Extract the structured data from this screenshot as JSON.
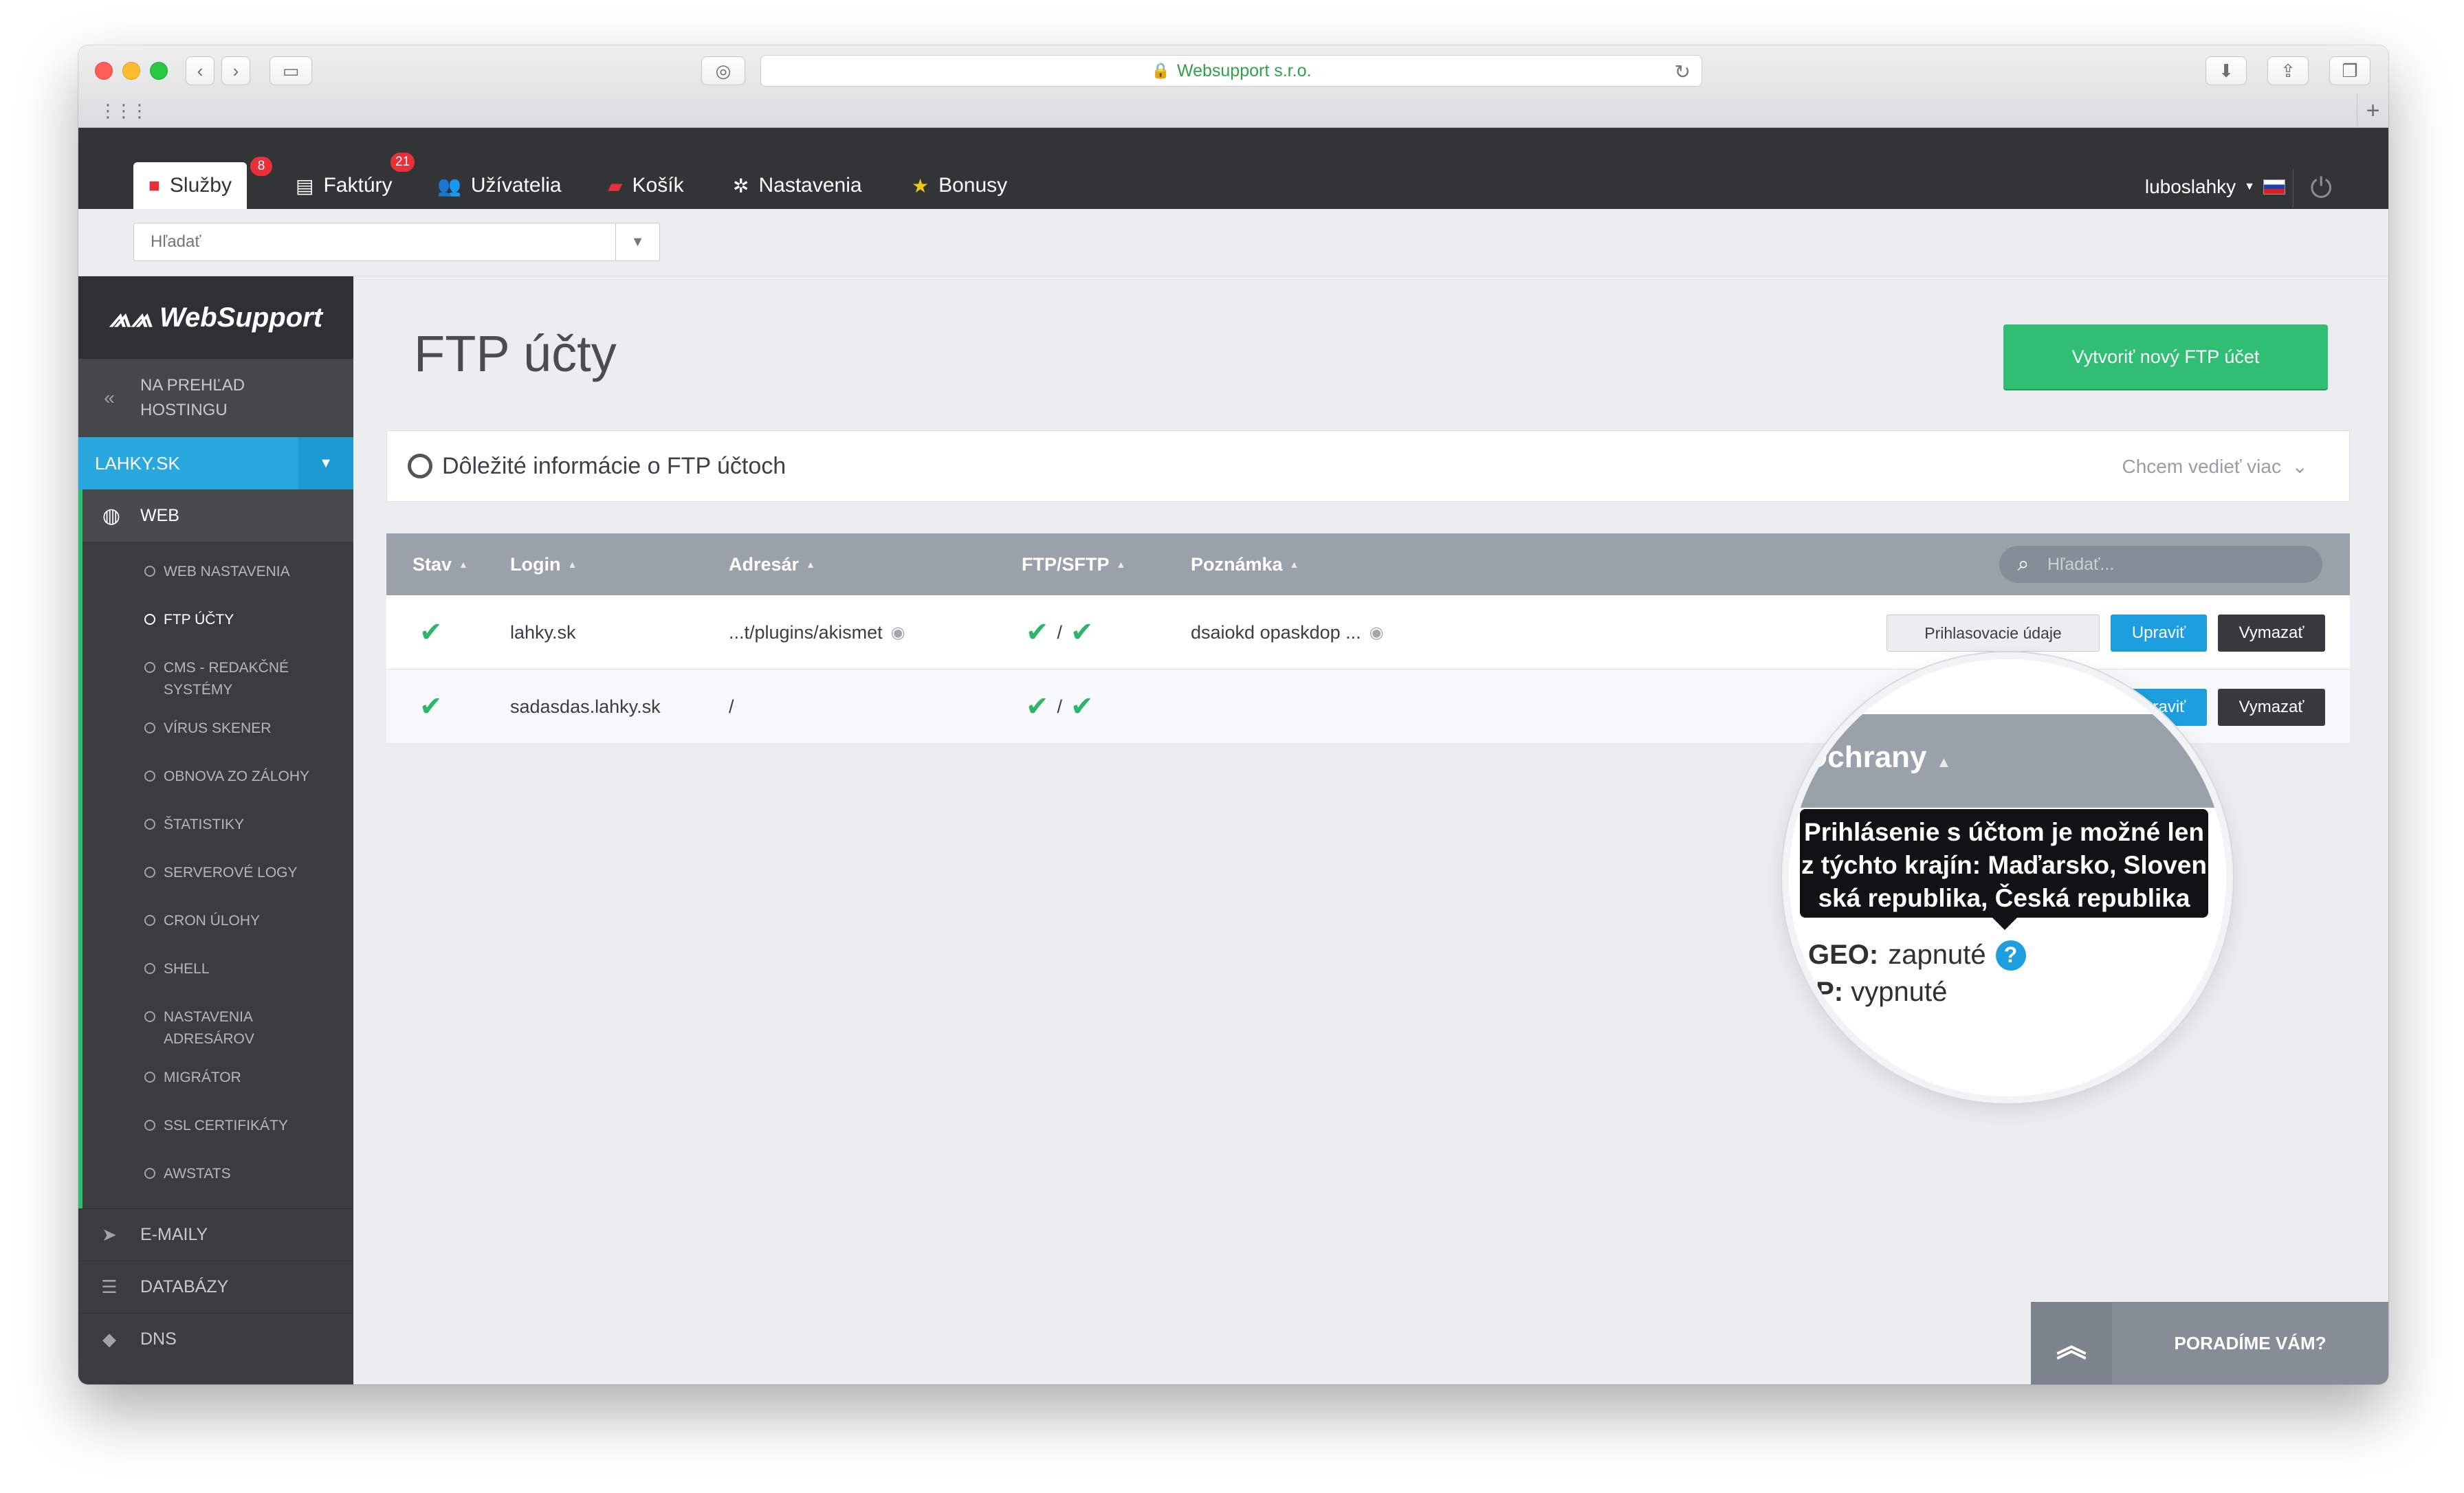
{
  "browser": {
    "url_title": "Websupport s.r.o.",
    "new_tab": "+"
  },
  "nav": {
    "tabs": [
      {
        "label": "Služby",
        "badge": "8"
      },
      {
        "label": "Faktúry",
        "badge": "21"
      },
      {
        "label": "Užívatelia"
      },
      {
        "label": "Košík"
      },
      {
        "label": "Nastavenia"
      },
      {
        "label": "Bonusy"
      }
    ],
    "user": "luboslahky"
  },
  "search": {
    "placeholder": "Hľadať"
  },
  "sidebar": {
    "logo": "WebSupport",
    "back_label_1": "NA PREHĽAD",
    "back_label_2": "HOSTINGU",
    "domain": "LAHKY.SK",
    "web": "WEB",
    "subitems": [
      "WEB NASTAVENIA",
      "FTP ÚČTY",
      "CMS - REDAKČNÉ SYSTÉMY",
      "VÍRUS SKENER",
      "OBNOVA ZO ZÁLOHY",
      "ŠTATISTIKY",
      "SERVEROVÉ LOGY",
      "CRON ÚLOHY",
      "SHELL",
      "NASTAVENIA ADRESÁROV",
      "MIGRÁTOR",
      "SSL CERTIFIKÁTY",
      "AWSTATS"
    ],
    "emails": "E-MAILY",
    "databases": "DATABÁZY",
    "dns": "DNS"
  },
  "main": {
    "title": "FTP účty",
    "create_button": "Vytvoriť nový FTP účet",
    "info_text": "Dôležité informácie o FTP účtoch",
    "info_more": "Chcem vedieť viac",
    "table": {
      "headers": {
        "state": "Stav",
        "login": "Login",
        "dir": "Adresár",
        "ftp": "FTP/SFTP",
        "note": "Poznámka"
      },
      "search_placeholder": "Hľadať...",
      "rows": [
        {
          "login": "lahky.sk",
          "dir": "...t/plugins/akismet",
          "ftp_sep": "/",
          "note": "dsaiokd opaskdop ..."
        },
        {
          "login": "sadasdas.lahky.sk",
          "dir": "/",
          "ftp_sep": "/",
          "note": ""
        }
      ],
      "btn_login": "Prihlasovacie údaje",
      "btn_edit": "Upraviť",
      "btn_delete": "Vymazať"
    }
  },
  "magnifier": {
    "header": "Ochrany",
    "tooltip_1": "Prihlásenie s účtom je možné len",
    "tooltip_2": "z týchto krajín: Maďarsko, Sloven",
    "tooltip_3": "ská republika, Česká republika",
    "geo_label": "GEO:",
    "geo_value": "zapnuté",
    "ip_label": "IP:",
    "ip_value": "vypnuté"
  },
  "help": {
    "label": "PORADÍME VÁM?"
  },
  "colors": {
    "accent_green": "#2fbe73",
    "accent_blue": "#1d9fdf",
    "nav_dark": "#323436"
  }
}
